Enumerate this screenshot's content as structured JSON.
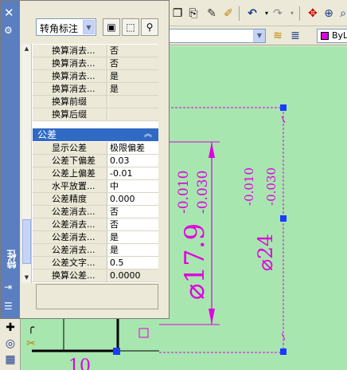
{
  "palette": {
    "title": "特性",
    "selected_object": "转角标注",
    "rows_top": [
      {
        "name": "换算消去...",
        "value": "否"
      },
      {
        "name": "换算消去...",
        "value": "否"
      },
      {
        "name": "换算消去...",
        "value": "是"
      },
      {
        "name": "换算消去...",
        "value": "是"
      },
      {
        "name": "换算前缀",
        "value": ""
      },
      {
        "name": "换算后缀",
        "value": ""
      }
    ],
    "section_title": "公差",
    "rows_tol": [
      {
        "name": "显示公差",
        "value": "极限偏差"
      },
      {
        "name": "公差下偏差",
        "value": "0.03"
      },
      {
        "name": "公差上偏差",
        "value": "-0.01"
      },
      {
        "name": "水平放置...",
        "value": "中"
      },
      {
        "name": "公差精度",
        "value": "0.000"
      },
      {
        "name": "公差消去...",
        "value": "否"
      },
      {
        "name": "公差消去...",
        "value": "否"
      },
      {
        "name": "公差消去...",
        "value": "是"
      },
      {
        "name": "公差消去...",
        "value": "是"
      },
      {
        "name": "公差文字...",
        "value": "0.5"
      },
      {
        "name": "换算公差...",
        "value": "0.0000"
      }
    ]
  },
  "toolbar": {
    "layer_label": "ByL"
  },
  "drawing": {
    "dim1_main": "⌀17.9",
    "dim1_upper": "-0.010",
    "dim1_lower": "-0.030",
    "dim2_main": "⌀24",
    "dim2_upper": "-0.010",
    "dim2_lower": "-0.030",
    "partial_text": "10"
  },
  "colors": {
    "canvas_bg": "#a8e6b0",
    "dimension": "#e000e0",
    "grip": "#1a3cff",
    "palette_side": "#5a7ebf",
    "section_header": "#316ac5"
  }
}
